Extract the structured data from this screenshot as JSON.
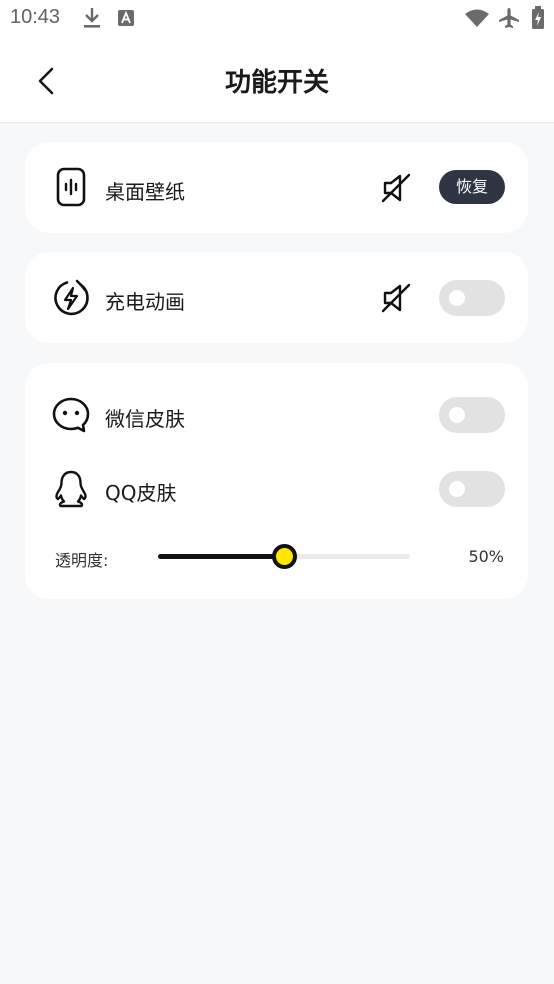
{
  "status_bar": {
    "time": "10:43",
    "icons": [
      "download-icon",
      "font-a-icon",
      "wifi-icon",
      "airplane-mode-icon",
      "battery-charging-icon"
    ]
  },
  "header": {
    "title": "功能开关"
  },
  "wallpaper": {
    "label": "桌面壁纸",
    "muted": true,
    "restore_label": "恢复"
  },
  "charging_animation": {
    "label": "充电动画",
    "muted": true,
    "enabled": false
  },
  "skins": {
    "wechat_label": "微信皮肤",
    "wechat_enabled": false,
    "qq_label": "QQ皮肤",
    "qq_enabled": false,
    "opacity_label": "透明度:",
    "opacity_value_text": "50%",
    "opacity_value": 0.5
  },
  "colors": {
    "accent_thumb": "#ffe600",
    "restore_button_bg": "#2f3542",
    "toggle_off_bg": "#e2e2e2",
    "page_bg": "#f7f8fa"
  }
}
